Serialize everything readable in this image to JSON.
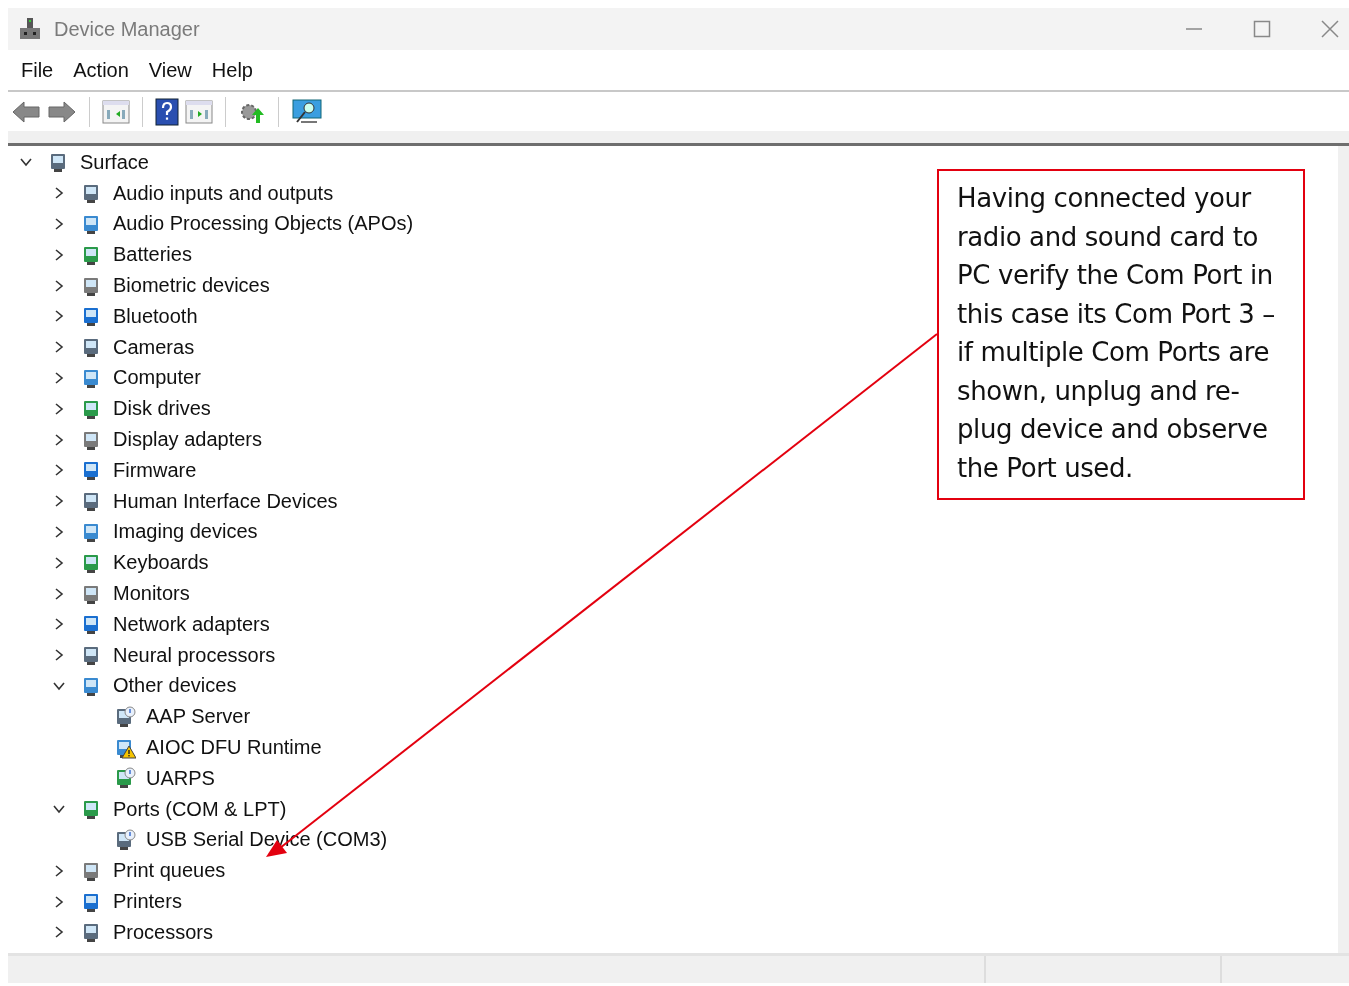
{
  "window": {
    "title": "Device Manager"
  },
  "menu": [
    "File",
    "Action",
    "View",
    "Help"
  ],
  "tree": [
    {
      "label": "Surface",
      "expanded": true,
      "children": [
        {
          "label": "Audio inputs and outputs",
          "expanded": false
        },
        {
          "label": "Audio Processing Objects (APOs)",
          "expanded": false
        },
        {
          "label": "Batteries",
          "expanded": false
        },
        {
          "label": "Biometric devices",
          "expanded": false
        },
        {
          "label": "Bluetooth",
          "expanded": false
        },
        {
          "label": "Cameras",
          "expanded": false
        },
        {
          "label": "Computer",
          "expanded": false
        },
        {
          "label": "Disk drives",
          "expanded": false
        },
        {
          "label": "Display adapters",
          "expanded": false
        },
        {
          "label": "Firmware",
          "expanded": false
        },
        {
          "label": "Human Interface Devices",
          "expanded": false
        },
        {
          "label": "Imaging devices",
          "expanded": false
        },
        {
          "label": "Keyboards",
          "expanded": false
        },
        {
          "label": "Monitors",
          "expanded": false
        },
        {
          "label": "Network adapters",
          "expanded": false
        },
        {
          "label": "Neural processors",
          "expanded": false
        },
        {
          "label": "Other devices",
          "expanded": true,
          "children": [
            {
              "label": "AAP Server",
              "warning": false
            },
            {
              "label": "AIOC DFU Runtime",
              "warning": true
            },
            {
              "label": "UARPS",
              "warning": false
            }
          ]
        },
        {
          "label": "Ports (COM & LPT)",
          "expanded": true,
          "children": [
            {
              "label": "USB Serial Device (COM3)",
              "warning": false
            }
          ]
        },
        {
          "label": "Print queues",
          "expanded": false
        },
        {
          "label": "Printers",
          "expanded": false
        },
        {
          "label": "Processors",
          "expanded": false
        }
      ]
    }
  ],
  "callout": {
    "text": "Having connected your radio and sound card to PC verify the Com Port in this case its Com Port 3 – if multiple Com Ports are shown, unplug and re-plug device and observe the Port used."
  }
}
